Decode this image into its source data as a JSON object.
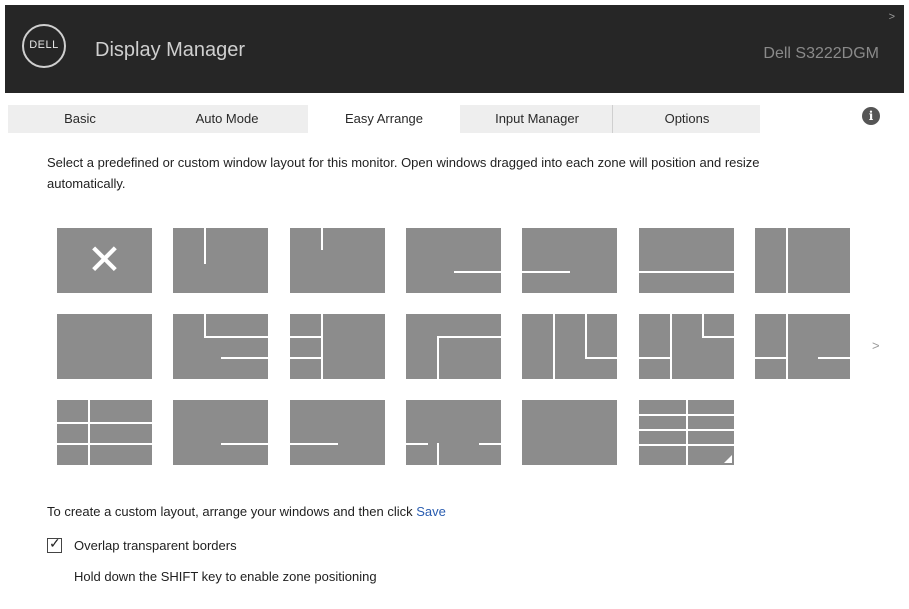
{
  "header": {
    "logo_text": "DELL",
    "app_title": "Display Manager",
    "model": "Dell S3222DGM",
    "chevron": ">"
  },
  "tabs": [
    "Basic",
    "Auto Mode",
    "Easy Arrange",
    "Input Manager",
    "Options"
  ],
  "active_tab": "Easy Arrange",
  "info_icon": "i",
  "instructions": "Select a predefined or custom window layout for this monitor.  Open windows dragged into each zone will position and resize automatically.",
  "layouts": {
    "selected_mark": "✕",
    "more_arrow": ">"
  },
  "bottom": {
    "custom_text": "To create a custom layout, arrange your windows and then click",
    "save_link": "Save",
    "overlap_label": "Overlap transparent borders",
    "overlap_checked": true,
    "check_mark": "✓",
    "hint": "Hold down the SHIFT key to enable zone positioning"
  }
}
